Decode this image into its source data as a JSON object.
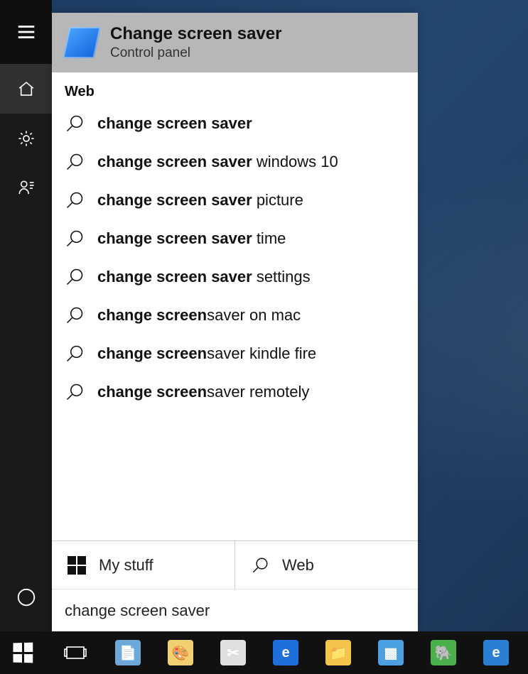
{
  "best_match": {
    "title": "Change screen saver",
    "subtitle": "Control panel"
  },
  "section_web_header": "Web",
  "suggestions": [
    {
      "bold": "change screen saver",
      "rest": ""
    },
    {
      "bold": "change screen saver",
      "rest": " windows 10"
    },
    {
      "bold": "change screen saver",
      "rest": " picture"
    },
    {
      "bold": "change screen saver",
      "rest": " time"
    },
    {
      "bold": "change screen saver",
      "rest": " settings"
    },
    {
      "bold": "change screen",
      "rest": "saver on mac"
    },
    {
      "bold": "change screen",
      "rest": "saver kindle fire"
    },
    {
      "bold": "change screen",
      "rest": "saver remotely"
    }
  ],
  "footer": {
    "mystuff": "My stuff",
    "web": "Web"
  },
  "search_value": "change screen saver",
  "taskbar_apps": [
    {
      "name": "notepad",
      "color": "#6fa8d6",
      "glyph": "📄"
    },
    {
      "name": "paint",
      "color": "#f0d070",
      "glyph": "🎨"
    },
    {
      "name": "snipping-tool",
      "color": "#e0e0e0",
      "glyph": "✂"
    },
    {
      "name": "edge",
      "color": "#1e6fd9",
      "glyph": "e"
    },
    {
      "name": "file-explorer",
      "color": "#f3c34b",
      "glyph": "📁"
    },
    {
      "name": "task-manager",
      "color": "#4aa0e0",
      "glyph": "▦"
    },
    {
      "name": "evernote",
      "color": "#49b04b",
      "glyph": "🐘"
    },
    {
      "name": "internet-explorer",
      "color": "#2a7fd4",
      "glyph": "e"
    }
  ]
}
